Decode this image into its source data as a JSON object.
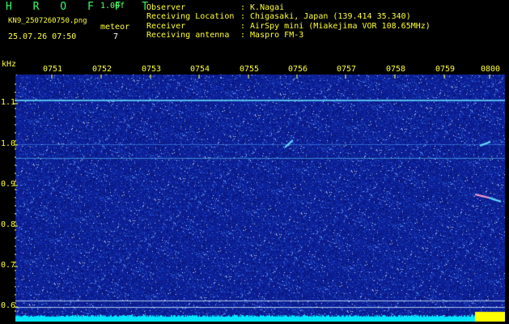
{
  "header": {
    "app_title": "H R O F F T",
    "scale": "1.00f",
    "filename": "KN9_2507260750.png",
    "meteor_label": "meteor",
    "meteor_count": "7",
    "datetime": "25.07.26 07:50"
  },
  "info": {
    "rows": [
      {
        "label": "Observer",
        "value": ": K.Nagai"
      },
      {
        "label": "Receiving Location",
        "value": ": Chigasaki, Japan (139.414 35.340)"
      },
      {
        "label": "Receiver",
        "value": ": AirSpy mini (Miakejima VOR 108.65MHz)"
      },
      {
        "label": "Receiving antenna",
        "value": ": Maspro FM-3"
      }
    ]
  },
  "axes": {
    "y_unit": "kHz",
    "y_ticks": [
      "1.1",
      "1.0",
      "0.9",
      "0.8",
      "0.7",
      "0.6"
    ],
    "x_ticks": [
      "0751",
      "0752",
      "0753",
      "0754",
      "0755",
      "0756",
      "0757",
      "0758",
      "0759",
      "0800"
    ]
  },
  "colors": {
    "background": "#000000",
    "spectrogram_bg": "#0a1f8f",
    "label_yellow": "#ffff33",
    "title_green": "#33ff66",
    "trace_cyan": "#66e0ff",
    "meter_cyan": "#00e5ff",
    "meter_yellow": "#ffff00"
  }
}
